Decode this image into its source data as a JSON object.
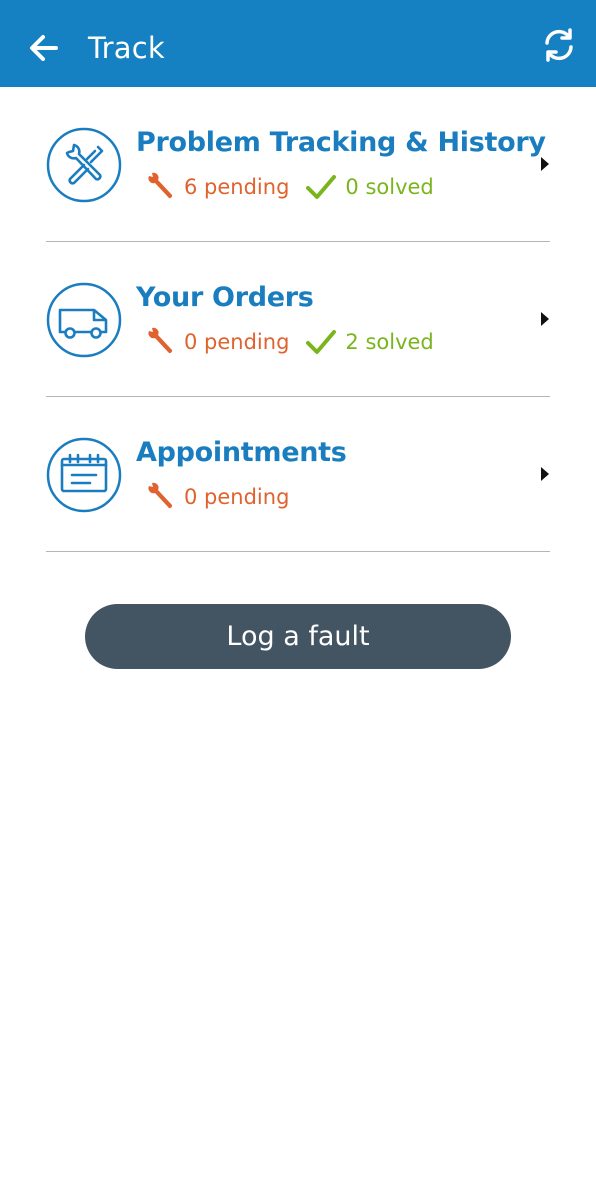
{
  "header": {
    "title": "Track",
    "back_icon": "arrow-left-icon",
    "refresh_icon": "refresh-icon",
    "background_color": "#1580c2"
  },
  "items": [
    {
      "title": "Problem Tracking & History",
      "icon": "tools-icon",
      "pending": "6 pending",
      "solved": "0 solved"
    },
    {
      "title": "Your Orders",
      "icon": "truck-icon",
      "pending": "0 pending",
      "solved": "2 solved"
    },
    {
      "title": "Appointments",
      "icon": "calendar-icon",
      "pending": "0 pending"
    }
  ],
  "colors": {
    "title": "#1a7dbf",
    "pending": "#e0622e",
    "solved": "#7ab51d",
    "button": "#435563"
  },
  "action_button": {
    "label": "Log a fault"
  }
}
